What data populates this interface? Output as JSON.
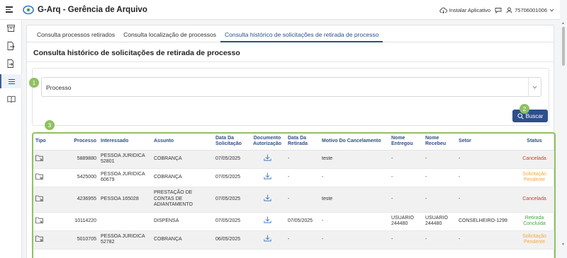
{
  "app": {
    "title": "G-Arq - Gerência de Arquivo"
  },
  "header": {
    "install_label": "Instalar Aplicativo",
    "user_label": "75706001006"
  },
  "tabs": [
    {
      "label": "Consulta processos retirados",
      "active": false
    },
    {
      "label": "Consulta localização de processos",
      "active": false
    },
    {
      "label": "Consulta histórico de solicitações de retirada de processo",
      "active": true
    }
  ],
  "section": {
    "title": "Consulta histórico de solicitações de retirada de processo"
  },
  "filter": {
    "select_value": "Processo",
    "search_label": "Buscar"
  },
  "badges": [
    "1",
    "2",
    "3"
  ],
  "table": {
    "columns": [
      "Tipo",
      "Processo",
      "Interessado",
      "Assunto",
      "Data Da Solicitação",
      "Documento Autorização",
      "Data Da Retirada",
      "Motivo Do Cancelamento",
      "Nome Entregou",
      "Nome Recebeu",
      "Setor",
      "Status"
    ],
    "rows": [
      {
        "processo": "5889880",
        "interessado": "PESSOA JURIDICA 52801",
        "assunto": "COBRANÇA",
        "data_solicitacao": "07/05/2025",
        "data_retirada": "-",
        "motivo": "teste",
        "nome_entregou": "-",
        "nome_recebeu": "-",
        "setor": "-",
        "status": "Cancelada",
        "status_type": "canc"
      },
      {
        "processo": "5425000",
        "interessado": "PESSOA JURIDICA 60679",
        "assunto": "COBRANÇA",
        "data_solicitacao": "07/05/2025",
        "data_retirada": "-",
        "motivo": "-",
        "nome_entregou": "-",
        "nome_recebeu": "-",
        "setor": "-",
        "status": "Solicitação Pendente",
        "status_type": "pend"
      },
      {
        "processo": "4236955",
        "interessado": "PESSOA 165028",
        "assunto": "PRESTAÇÃO DE CONTAS DE ADIANTAMENTO",
        "data_solicitacao": "07/05/2025",
        "data_retirada": "-",
        "motivo": "teste",
        "nome_entregou": "-",
        "nome_recebeu": "-",
        "setor": "-",
        "status": "Cancelada",
        "status_type": "canc"
      },
      {
        "processo": "10114220",
        "interessado": "",
        "assunto": "DISPENSA",
        "data_solicitacao": "07/05/2025",
        "data_retirada": "07/05/2025",
        "motivo": "-",
        "nome_entregou": "USUARIO 244480",
        "nome_recebeu": "USUARIO 244480",
        "setor": "CONSELHEIRO-1299",
        "status": "Retirada Concluída",
        "status_type": "ret"
      },
      {
        "processo": "5010705",
        "interessado": "PESSOA JURIDICA 52782",
        "assunto": "COBRANÇA",
        "data_solicitacao": "06/05/2025",
        "data_retirada": "-",
        "motivo": "-",
        "nome_entregou": "-",
        "nome_recebeu": "-",
        "setor": "-",
        "status": "Solicitação Pendente",
        "status_type": "pend"
      }
    ]
  },
  "colors": {
    "primary": "#2d4f8a",
    "highlight": "#8fc163",
    "cancelled": "#d83a2e",
    "pending": "#f2a93b",
    "done": "#4aa33c"
  },
  "icons": [
    "menu-icon",
    "logo-icon",
    "cloud-download-icon",
    "chat-icon",
    "user-icon",
    "chevron-down-icon",
    "archive-icon",
    "file-export-icon",
    "file-import-icon",
    "list-icon",
    "book-icon",
    "search-icon",
    "folder-pointer-icon",
    "download-icon"
  ]
}
